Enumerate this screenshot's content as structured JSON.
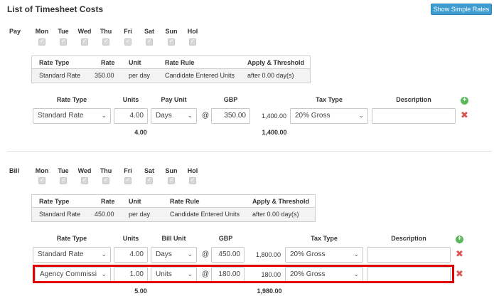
{
  "header": {
    "title": "List of Timesheet Costs",
    "show_simple_rates": "Show Simple Rates"
  },
  "days": [
    "Mon",
    "Tue",
    "Wed",
    "Thu",
    "Fri",
    "Sat",
    "Sun",
    "Hol"
  ],
  "pay": {
    "label": "Pay",
    "rate_table": {
      "headers": [
        "Rate Type",
        "Rate",
        "Unit",
        "Rate Rule",
        "Apply & Threshold"
      ],
      "row": [
        "Standard Rate",
        "350.00",
        "per day",
        "Candidate Entered Units",
        "after 0.00 day(s)"
      ]
    },
    "columns": {
      "rate_type": "Rate Type",
      "units": "Units",
      "unit": "Pay Unit",
      "currency": "GBP",
      "tax_type": "Tax Type",
      "description": "Description"
    },
    "lines": [
      {
        "rate_type": "Standard Rate",
        "units": "4.00",
        "unit": "Days",
        "at": "@",
        "rate": "350.00",
        "amount": "1,400.00",
        "tax_type": "20% Gross",
        "description": ""
      }
    ],
    "totals": {
      "units": "4.00",
      "amount": "1,400.00"
    }
  },
  "bill": {
    "label": "Bill",
    "rate_table": {
      "headers": [
        "Rate Type",
        "Rate",
        "Unit",
        "Rate Rule",
        "Apply & Threshold"
      ],
      "row": [
        "Standard Rate",
        "450.00",
        "per day",
        "Candidate Entered Units",
        "after 0.00 day(s)"
      ]
    },
    "columns": {
      "rate_type": "Rate Type",
      "units": "Units",
      "unit": "Bill Unit",
      "currency": "GBP",
      "tax_type": "Tax Type",
      "description": "Description"
    },
    "lines": [
      {
        "rate_type": "Standard Rate",
        "units": "4.00",
        "unit": "Days",
        "at": "@",
        "rate": "450.00",
        "amount": "1,800.00",
        "tax_type": "20% Gross",
        "description": ""
      },
      {
        "rate_type": "Agency Commissi",
        "units": "1.00",
        "unit": "Units",
        "at": "@",
        "rate": "180.00",
        "amount": "180.00",
        "tax_type": "20% Gross",
        "description": ""
      }
    ],
    "totals": {
      "units": "5.00",
      "amount": "1,980.00"
    }
  },
  "colors": {
    "button_blue": "#3d9dd1",
    "add_green": "#5cb85c",
    "delete_red": "#d9534f",
    "highlight_red": "#e00000"
  }
}
